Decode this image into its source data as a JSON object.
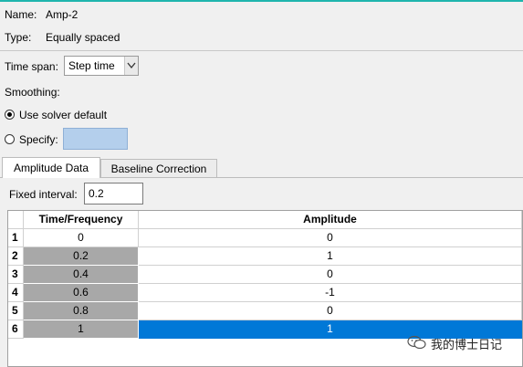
{
  "name": {
    "label": "Name:",
    "value": "Amp-2"
  },
  "type": {
    "label": "Type:",
    "value": "Equally spaced"
  },
  "time_span": {
    "label": "Time span:",
    "selected": "Step time"
  },
  "smoothing": {
    "label": "Smoothing:",
    "option_default": "Use solver default",
    "option_specify": "Specify:"
  },
  "tabs": [
    {
      "label": "Amplitude Data"
    },
    {
      "label": "Baseline Correction"
    }
  ],
  "fixed_interval": {
    "label": "Fixed interval:",
    "value": "0.2"
  },
  "table": {
    "headers": [
      "Time/Frequency",
      "Amplitude"
    ],
    "rows": [
      {
        "index": "1",
        "time": "0",
        "amplitude": "0"
      },
      {
        "index": "2",
        "time": "0.2",
        "amplitude": "1"
      },
      {
        "index": "3",
        "time": "0.4",
        "amplitude": "0"
      },
      {
        "index": "4",
        "time": "0.6",
        "amplitude": "-1"
      },
      {
        "index": "5",
        "time": "0.8",
        "amplitude": "0"
      },
      {
        "index": "6",
        "time": "1",
        "amplitude": "1"
      }
    ]
  },
  "watermark": {
    "text": "我的博士日记"
  },
  "colors": {
    "accent_top": "#1fb5ad",
    "selection": "#0078d7",
    "specify_field": "#b4cfec",
    "locked_cell": "#a8a8a8"
  }
}
